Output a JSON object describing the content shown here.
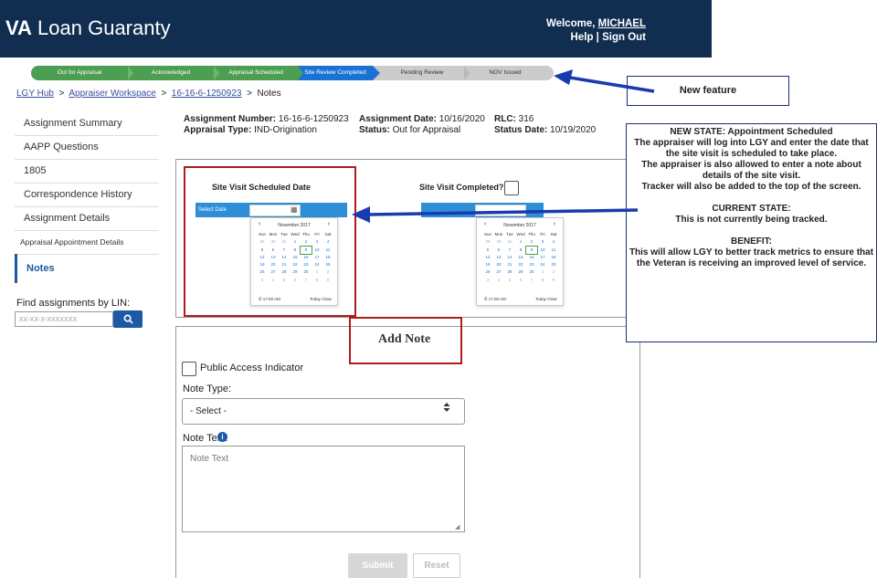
{
  "header": {
    "brand_bold": "VA",
    "brand_rest": " Loan Guaranty",
    "welcome_prefix": "Welcome, ",
    "user": "MICHAEL",
    "help": "Help",
    "sep": " | ",
    "signout": "Sign Out"
  },
  "tracker": {
    "steps": [
      "Out for Appraisal",
      "Acknowledged",
      "Appraisal Scheduled",
      "Site Review Completed",
      "Pending Review",
      "NOV Issued"
    ]
  },
  "breadcrumb": {
    "items": [
      "LGY Hub",
      "Appraiser Workspace",
      "16-16-6-1250923"
    ],
    "current": "Notes",
    "sep": ">"
  },
  "sidebar": {
    "items": [
      "Assignment Summary",
      "AAPP Questions",
      "1805",
      "Correspondence History",
      "Assignment Details",
      "Appraisal Appointment Details",
      "Notes"
    ],
    "find_label": "Find assignments by LIN:",
    "find_placeholder": "XX-XX-X-XXXXXXX"
  },
  "assignment": {
    "number_label": "Assignment Number:",
    "number": "16-16-6-1250923",
    "date_label": "Assignment Date:",
    "date": "10/16/2020",
    "rlc_label": "RLC:",
    "rlc": "316",
    "type_label": "Appraisal Type:",
    "type": "IND-Origination",
    "status_label": "Status:",
    "status": "Out for Appraisal",
    "status_date_label": "Status Date:",
    "status_date": "10/19/2020"
  },
  "site_visit": {
    "scheduled_title": "Site Visit Scheduled Date",
    "completed_title": "Site Visit Completed?",
    "select_date": "Select Date",
    "calendar": {
      "month": "November 2017",
      "days": [
        "Sun",
        "Mon",
        "Tue",
        "Wed",
        "Thu",
        "Fri",
        "Sat"
      ],
      "weeks": [
        [
          "29",
          "30",
          "31",
          "1",
          "2",
          "3",
          "4"
        ],
        [
          "5",
          "6",
          "7",
          "8",
          "9",
          "10",
          "11"
        ],
        [
          "12",
          "13",
          "14",
          "15",
          "16",
          "17",
          "18"
        ],
        [
          "19",
          "20",
          "21",
          "22",
          "23",
          "24",
          "25"
        ],
        [
          "26",
          "27",
          "28",
          "29",
          "30",
          "1",
          "2"
        ],
        [
          "3",
          "4",
          "5",
          "6",
          "7",
          "8",
          "9"
        ]
      ],
      "time": "17:00 AM",
      "today": "Today",
      "clear": "Clear"
    }
  },
  "note_form": {
    "title": "Add Note",
    "public_label": "Public Access Indicator",
    "type_label": "Note Type:",
    "type_value": "- Select -",
    "text_label": "Note Text:",
    "text_placeholder": "Note Text",
    "submit": "Submit",
    "reset": "Reset"
  },
  "callouts": {
    "new_feature": "New feature",
    "lines": [
      "NEW STATE: Appointment Scheduled",
      "The appraiser will log into LGY and enter the date that the site visit is scheduled to take place.",
      "The appraiser is also allowed to enter a note about details of the site visit.",
      "Tracker will also be added to the top of the screen.",
      "",
      "CURRENT STATE:",
      "This is not currently being tracked.",
      "",
      "BENEFIT:",
      "This will allow LGY to better track metrics to ensure that the Veteran is receiving an improved level of service."
    ]
  },
  "colors": {
    "header_bg": "#112e51",
    "step_done": "#4c9e52",
    "step_current": "#1a73d4",
    "accent_blue": "#1c5aa6",
    "highlight_red": "#b01c1c",
    "arrow_blue": "#1a3ab0"
  }
}
